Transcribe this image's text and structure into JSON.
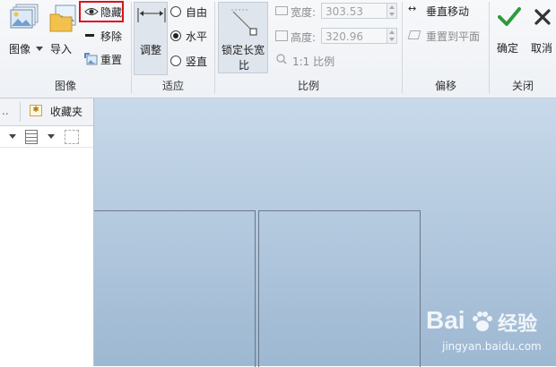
{
  "ribbon": {
    "image_group": {
      "label": "图像",
      "image_button": "图像",
      "import_button": "导入",
      "hide_button": "隐藏",
      "remove_button": "移除",
      "reset_button": "重置"
    },
    "fit_group": {
      "label": "适应",
      "adjust_button": "调整",
      "options": [
        "自由",
        "水平",
        "竖直"
      ],
      "selected": "水平"
    },
    "scale_group": {
      "label": "比例",
      "lock_button_line1": "锁定长宽",
      "lock_button_line2": "比",
      "width_label": "宽度:",
      "width_value": "303.53",
      "height_label": "高度:",
      "height_value": "320.96",
      "ratio_label": "1:1 比例"
    },
    "offset_group": {
      "label": "偏移",
      "vertical_move": "垂直移动",
      "reset_to_plane": "重置到平面"
    },
    "close_group": {
      "label": "关闭",
      "ok_button": "确定",
      "cancel_button": "取消"
    }
  },
  "side_panel": {
    "tab_collapsed": "..",
    "favorites_tab": "收藏夹"
  },
  "watermark": {
    "brand": "Bai",
    "brand2": "经验",
    "url": "jingyan.baidu.com"
  },
  "colors": {
    "highlight_box": "#d9141c",
    "ok_check": "#2e9a3e",
    "canvas_top": "#c8d9ea",
    "canvas_bottom": "#9db8d2"
  }
}
